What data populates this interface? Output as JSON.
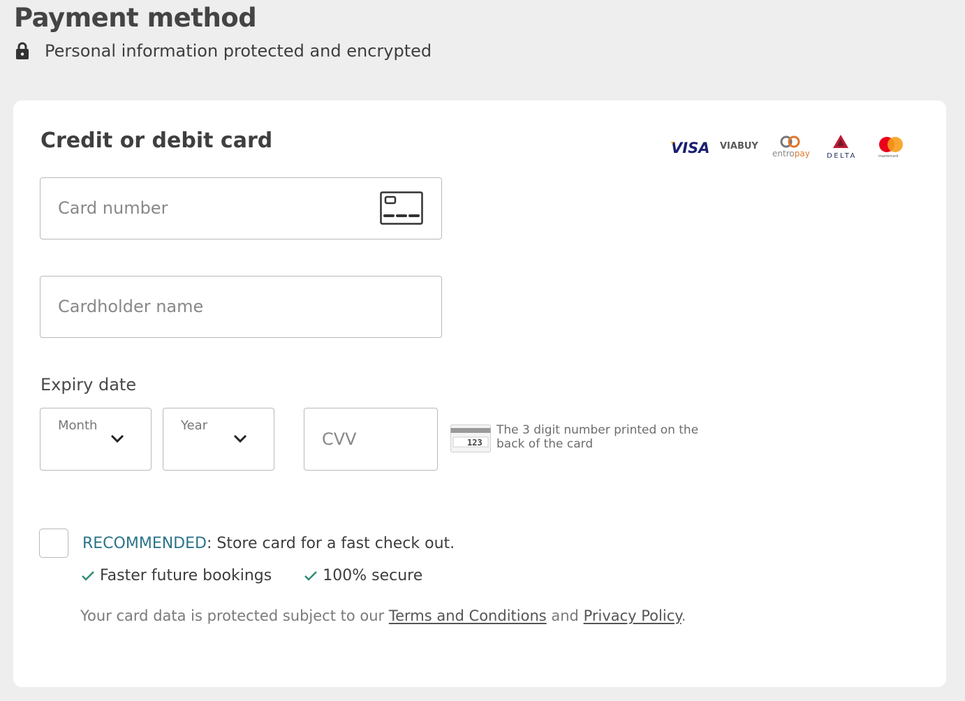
{
  "header": {
    "title": "Payment method",
    "secure_text": "Personal information protected and encrypted",
    "lock_icon": "lock-icon"
  },
  "card_form": {
    "title": "Credit or debit card",
    "logos": [
      {
        "name": "visa",
        "text": "VISA",
        "color": "#1a1f71"
      },
      {
        "name": "viabuy",
        "text": "VIABUY",
        "color": "#5a5a5a"
      },
      {
        "name": "entropay",
        "text_a": "entro",
        "text_b": "pay",
        "color_a": "#888888",
        "color_b": "#e0762c"
      },
      {
        "name": "delta",
        "text": "DELTA",
        "color": "#c01933"
      },
      {
        "name": "mastercard",
        "text": "mastercard",
        "color_red": "#eb001b",
        "color_orange": "#f79e1b"
      }
    ],
    "card_number": {
      "placeholder": "Card number",
      "icon": "credit-card-icon"
    },
    "cardholder_name": {
      "placeholder": "Cardholder name"
    },
    "expiry": {
      "label": "Expiry date",
      "month_label": "Month",
      "year_label": "Year"
    },
    "cvv": {
      "placeholder": "CVV",
      "sample_digits": "123",
      "hint": "The 3 digit number printed on the back of the card"
    },
    "store": {
      "recommended": "RECOMMENDED",
      "text": ": Store card for a fast check out.",
      "checked": false
    },
    "benefits": [
      {
        "text": "Faster future bookings"
      },
      {
        "text": "100% secure"
      }
    ],
    "legal": {
      "prefix": "Your card data is protected subject to our ",
      "terms_link": "Terms and Conditions",
      "middle": " and ",
      "privacy_link": "Privacy Policy",
      "suffix": "."
    }
  },
  "colors": {
    "background": "#eeeeee",
    "accent_teal": "#2b7489",
    "check_green": "#2e8b74"
  }
}
